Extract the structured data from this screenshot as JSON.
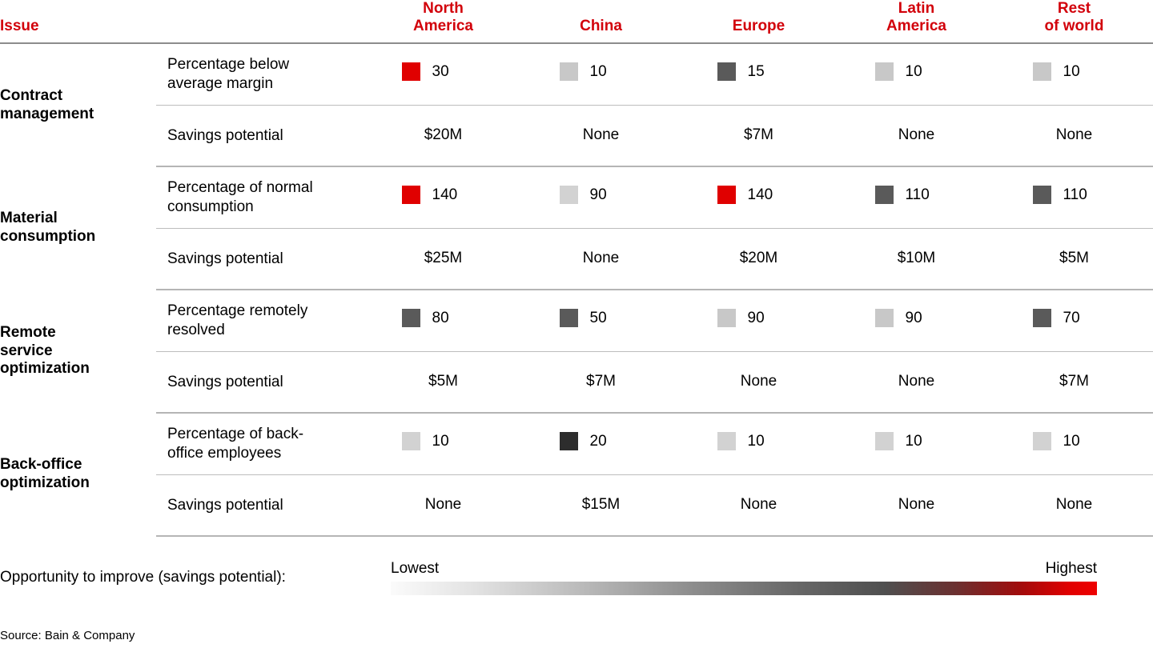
{
  "header": {
    "issue_label": "Issue",
    "regions": [
      "North\nAmerica",
      "China",
      "Europe",
      "Latin\nAmerica",
      "Rest\nof world"
    ]
  },
  "colors": {
    "accent_red": "#d2000a",
    "swatch_red": "#e00000",
    "swatch_very_dark": "#2d2d2d",
    "swatch_dark_gray": "#5a5a5a",
    "swatch_light_gray": "#c8c8c8",
    "rule_gray": "#8c8c8c"
  },
  "groups": [
    {
      "issue": "Contract\nmanagement",
      "metric_label": "Percentage below\naverage margin",
      "metric_values": [
        {
          "value": "30",
          "swatch": "#e00000"
        },
        {
          "value": "10",
          "swatch": "#c8c8c8"
        },
        {
          "value": "15",
          "swatch": "#5a5a5a"
        },
        {
          "value": "10",
          "swatch": "#c8c8c8"
        },
        {
          "value": "10",
          "swatch": "#c8c8c8"
        }
      ],
      "savings_label": "Savings potential",
      "savings_values": [
        "$20M",
        "None",
        "$7M",
        "None",
        "None"
      ]
    },
    {
      "issue": "Material\nconsumption",
      "metric_label": "Percentage of normal\nconsumption",
      "metric_values": [
        {
          "value": "140",
          "swatch": "#e00000"
        },
        {
          "value": "90",
          "swatch": "#d2d2d2"
        },
        {
          "value": "140",
          "swatch": "#e00000"
        },
        {
          "value": "110",
          "swatch": "#5a5a5a"
        },
        {
          "value": "110",
          "swatch": "#5a5a5a"
        }
      ],
      "savings_label": "Savings potential",
      "savings_values": [
        "$25M",
        "None",
        "$20M",
        "$10M",
        "$5M"
      ]
    },
    {
      "issue": "Remote\nservice\noptimization",
      "metric_label": "Percentage remotely\nresolved",
      "metric_values": [
        {
          "value": "80",
          "swatch": "#5a5a5a"
        },
        {
          "value": "50",
          "swatch": "#5a5a5a"
        },
        {
          "value": "90",
          "swatch": "#c8c8c8"
        },
        {
          "value": "90",
          "swatch": "#c8c8c8"
        },
        {
          "value": "70",
          "swatch": "#5a5a5a"
        }
      ],
      "savings_label": "Savings potential",
      "savings_values": [
        "$5M",
        "$7M",
        "None",
        "None",
        "$7M"
      ]
    },
    {
      "issue": "Back-office\noptimization",
      "metric_label": "Percentage of back-\noffice employees",
      "metric_values": [
        {
          "value": "10",
          "swatch": "#d2d2d2"
        },
        {
          "value": "20",
          "swatch": "#2d2d2d"
        },
        {
          "value": "10",
          "swatch": "#d2d2d2"
        },
        {
          "value": "10",
          "swatch": "#d2d2d2"
        },
        {
          "value": "10",
          "swatch": "#d2d2d2"
        }
      ],
      "savings_label": "Savings potential",
      "savings_values": [
        "None",
        "$15M",
        "None",
        "None",
        "None"
      ]
    }
  ],
  "legend": {
    "label": "Opportunity to improve (savings potential):",
    "lowest": "Lowest",
    "highest": "Highest"
  },
  "source": "Source: Bain & Company",
  "chart_data": {
    "type": "heatmap",
    "title": "Opportunity to improve (savings potential)",
    "xlabel": "",
    "ylabel": "",
    "categories": [
      "North America",
      "China",
      "Europe",
      "Latin America",
      "Rest of world"
    ],
    "rows": [
      {
        "issue": "Contract management",
        "metric": "Percentage below average margin",
        "values": [
          30,
          10,
          15,
          10,
          10
        ],
        "swatches": [
          "#e00000",
          "#c8c8c8",
          "#5a5a5a",
          "#c8c8c8",
          "#c8c8c8"
        ],
        "savings_potential": [
          "$20M",
          "None",
          "$7M",
          "None",
          "None"
        ]
      },
      {
        "issue": "Material consumption",
        "metric": "Percentage of normal consumption",
        "values": [
          140,
          90,
          140,
          110,
          110
        ],
        "swatches": [
          "#e00000",
          "#d2d2d2",
          "#e00000",
          "#5a5a5a",
          "#5a5a5a"
        ],
        "savings_potential": [
          "$25M",
          "None",
          "$20M",
          "$10M",
          "$5M"
        ]
      },
      {
        "issue": "Remote service optimization",
        "metric": "Percentage remotely resolved",
        "values": [
          80,
          50,
          90,
          90,
          70
        ],
        "swatches": [
          "#5a5a5a",
          "#5a5a5a",
          "#c8c8c8",
          "#c8c8c8",
          "#5a5a5a"
        ],
        "savings_potential": [
          "$5M",
          "$7M",
          "None",
          "None",
          "$7M"
        ]
      },
      {
        "issue": "Back-office optimization",
        "metric": "Percentage of back-office employees",
        "values": [
          10,
          20,
          10,
          10,
          10
        ],
        "swatches": [
          "#d2d2d2",
          "#2d2d2d",
          "#d2d2d2",
          "#d2d2d2",
          "#d2d2d2"
        ],
        "savings_potential": [
          "None",
          "$15M",
          "None",
          "None",
          "None"
        ]
      }
    ],
    "legend": {
      "position": "bottom",
      "scale_low": "Lowest",
      "scale_high": "Highest",
      "gradient": [
        "#fbfbfb",
        "#bdbdbd",
        "#666666",
        "#4f4f4f",
        "#e00000"
      ]
    },
    "grid": false
  }
}
